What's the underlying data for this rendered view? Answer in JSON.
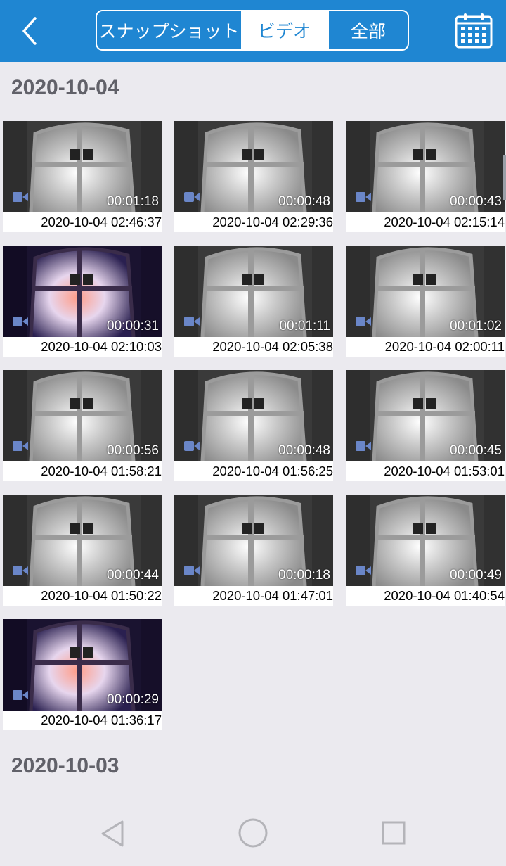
{
  "header": {
    "tabs": [
      {
        "label": "スナップショット",
        "selected": false
      },
      {
        "label": "ビデオ",
        "selected": true
      },
      {
        "label": "全部",
        "selected": false
      }
    ],
    "colors": {
      "bar": "#1f86d2",
      "selected_tab_text": "#1f86d2"
    },
    "icons": {
      "back": "chevron-left-icon",
      "calendar": "calendar-icon"
    }
  },
  "sections": [
    {
      "date": "2020-10-04",
      "videos": [
        {
          "duration": "00:01:18",
          "timestamp": "2020-10-04 02:46:37",
          "scene": "night-gray"
        },
        {
          "duration": "00:00:48",
          "timestamp": "2020-10-04 02:29:36",
          "scene": "night-gray"
        },
        {
          "duration": "00:00:43",
          "timestamp": "2020-10-04 02:15:14",
          "scene": "night-gray"
        },
        {
          "duration": "00:00:31",
          "timestamp": "2020-10-04 02:10:03",
          "scene": "color"
        },
        {
          "duration": "00:01:11",
          "timestamp": "2020-10-04 02:05:38",
          "scene": "night-gray"
        },
        {
          "duration": "00:01:02",
          "timestamp": "2020-10-04 02:00:11",
          "scene": "night-gray"
        },
        {
          "duration": "00:00:56",
          "timestamp": "2020-10-04 01:58:21",
          "scene": "night-gray"
        },
        {
          "duration": "00:00:48",
          "timestamp": "2020-10-04 01:56:25",
          "scene": "night-gray"
        },
        {
          "duration": "00:00:45",
          "timestamp": "2020-10-04 01:53:01",
          "scene": "night-gray"
        },
        {
          "duration": "00:00:44",
          "timestamp": "2020-10-04 01:50:22",
          "scene": "night-gray"
        },
        {
          "duration": "00:00:18",
          "timestamp": "2020-10-04 01:47:01",
          "scene": "night-gray"
        },
        {
          "duration": "00:00:49",
          "timestamp": "2020-10-04 01:40:54",
          "scene": "night-gray"
        },
        {
          "duration": "00:00:29",
          "timestamp": "2020-10-04 01:36:17",
          "scene": "color"
        }
      ]
    },
    {
      "date": "2020-10-03",
      "videos": []
    }
  ],
  "navbar": {
    "icons": [
      "triangle-back-icon",
      "circle-home-icon",
      "square-recents-icon"
    ]
  }
}
